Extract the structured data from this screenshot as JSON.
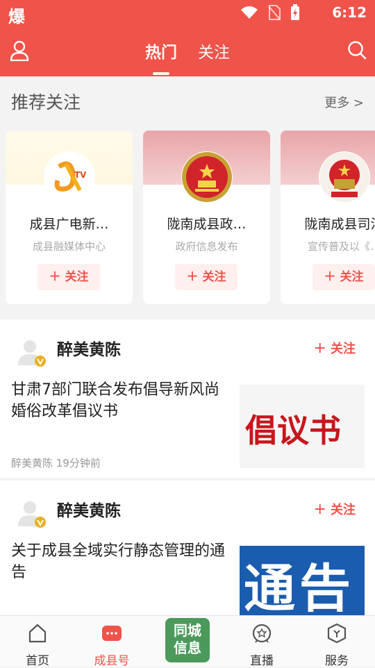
{
  "status_bar": {
    "left_glyph": "爆",
    "time": "6:12"
  },
  "header": {
    "tabs": [
      {
        "label": "热门",
        "active": true
      },
      {
        "label": "关注",
        "active": false
      }
    ]
  },
  "recommend": {
    "title": "推荐关注",
    "more": "更多 >",
    "cards": [
      {
        "name": "成县广电新…",
        "desc": "成县融媒体中心",
        "follow": "＋ 关注",
        "logo_text": "TV"
      },
      {
        "name": "陇南成县政…",
        "desc": "政府信息发布",
        "follow": "＋ 关注"
      },
      {
        "name": "陇南成县司法",
        "desc": "宣传普及以《…",
        "follow": "＋ 关注"
      }
    ]
  },
  "feed": [
    {
      "author": "醉美黄陈",
      "follow": "＋ 关注",
      "title": "甘肃7部门联合发布倡导新风尚婚俗改革倡议书",
      "meta": "醉美黄陈   19分钟前",
      "thumb_text": "倡议书"
    },
    {
      "author": "醉美黄陈",
      "follow": "＋ 关注",
      "title": "关于成县全域实行静态管理的通告",
      "thumb_text": "通告"
    }
  ],
  "bottom_nav": {
    "items": [
      {
        "label": "首页",
        "icon": "home-icon"
      },
      {
        "label": "成县号",
        "icon": "chat-icon",
        "active": true
      },
      {
        "label": "直播",
        "icon": "live-icon"
      },
      {
        "label": "服务",
        "icon": "service-icon"
      }
    ],
    "center": {
      "line1": "同城",
      "line2": "信息"
    }
  },
  "colors": {
    "accent": "#f0534a",
    "center_button": "#4c9a5b"
  }
}
